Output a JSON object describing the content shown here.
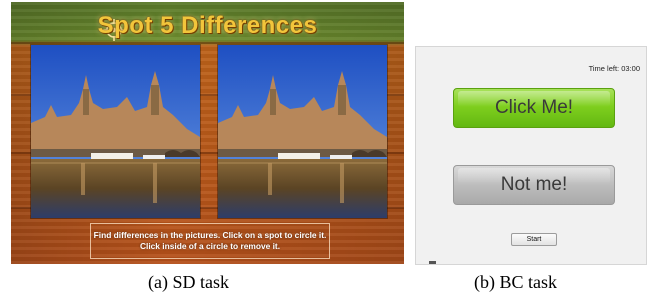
{
  "panel_a": {
    "title": "Spot 5 Differences",
    "title_icon": "crosshair-icon",
    "instructions": "Find differences in the pictures. Click on a spot to circle it. Click inside of a circle to remove it."
  },
  "panel_b": {
    "timer": "Time left: 03:00",
    "click_me_label": "Click Me!",
    "not_me_label": "Not me!",
    "start_label": "Start"
  },
  "captions": {
    "a": "(a)  SD task",
    "b": "(b)  BC task"
  },
  "colors": {
    "title": "#f2c53b",
    "click_me_green": "#7fcf1e",
    "not_me_gray": "#bdbdbd"
  }
}
